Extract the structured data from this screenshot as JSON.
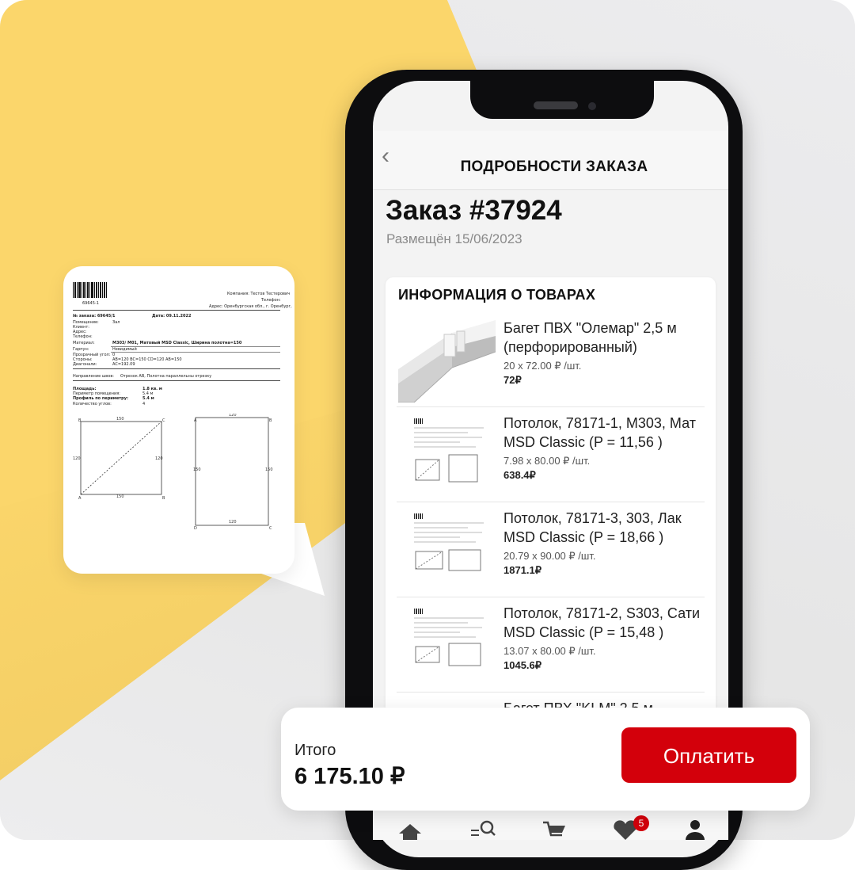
{
  "header": {
    "title": "ПОДРОБНОСТИ ЗАКАЗА"
  },
  "order": {
    "title": "Заказ #37924",
    "placed": "Размещён 15/06/2023"
  },
  "products": {
    "section_title": "ИНФОРМАЦИЯ О ТОВАРАХ",
    "items": [
      {
        "name": "Багет ПВХ \"Олемар\" 2,5 м (перфорированный)",
        "price": "20 x 72.00 ₽ /шт.",
        "total": "72₽"
      },
      {
        "name": "Потолок, 78171-1, M303, Мат MSD Classic (P = 11,56 )",
        "price": "7.98 x 80.00 ₽ /шт.",
        "total": "638.4₽"
      },
      {
        "name": "Потолок, 78171-3, 303, Лак MSD Classic (P = 18,66 )",
        "price": "20.79 x 90.00 ₽ /шт.",
        "total": "1871.1₽"
      },
      {
        "name": "Потолок, 78171-2, S303, Сати MSD Classic (P = 15,48 )",
        "price": "13.07 x 80.00 ₽ /шт.",
        "total": "1045.6₽"
      },
      {
        "name": "Багет ПВХ \"KLM\" 2,5 м",
        "price": "",
        "total": ""
      }
    ]
  },
  "summary": {
    "label": "Итого",
    "total": "6 175.10 ₽",
    "pay_label": "Оплатить"
  },
  "tabbar": {
    "favorites_badge": "5"
  },
  "document": {
    "barcode_number": "69645-1",
    "company": "Компания: Тестов Тестерович",
    "phone": "Телефон:",
    "address": "Адрес: Оренбургская обл., г. Оренбург,",
    "order_no": "№ заказа: 69645/1",
    "date": "Дата: 09.11.2022",
    "rows": [
      {
        "k": "Помещение:",
        "v": "Зал"
      },
      {
        "k": "Клиент:",
        "v": ""
      },
      {
        "k": "Адрес:",
        "v": ""
      },
      {
        "k": "Телефон:",
        "v": ""
      },
      {
        "k": "Материал:",
        "v": "M303/ M01, Матовый MSD Classic, Ширина полотна=150"
      },
      {
        "k": "Гарпун:",
        "v": "Невидимый"
      },
      {
        "k": "Прозрачный угол:",
        "v": "0"
      },
      {
        "k": "Стороны:",
        "v": "AB=120 BC=150 CD=120 AB=150"
      },
      {
        "k": "Диагонали:",
        "v": "AC=192.09"
      }
    ],
    "seam": "Направление швов:",
    "seam_value": "Отрезок AB, Полотна параллельны отрезку",
    "area_label": "Площадь:",
    "area_value": "1.8 кв. м",
    "perimeter_label": "Периметр помещения:",
    "perimeter_value": "5.4 м",
    "profile_label": "Профиль по периметру:",
    "profile_value": "5.4 м",
    "corners_label": "Количество углов:",
    "corners_value": "4"
  }
}
